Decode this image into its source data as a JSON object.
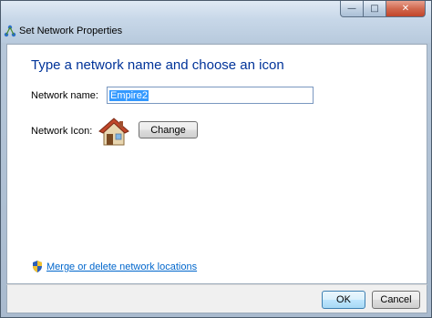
{
  "window": {
    "title": "Set Network Properties",
    "minimize_glyph": "—",
    "maximize_glyph": "□",
    "close_glyph": "✕"
  },
  "main": {
    "heading": "Type a network name and choose an icon",
    "network_name_label": "Network name:",
    "network_name_value": "Empire2",
    "network_icon_label": "Network Icon:",
    "network_icon": "house-icon",
    "change_button": "Change",
    "merge_link": "Merge or delete network locations",
    "merge_link_icon": "shield-icon"
  },
  "footer": {
    "ok_button": "OK",
    "cancel_button": "Cancel"
  }
}
